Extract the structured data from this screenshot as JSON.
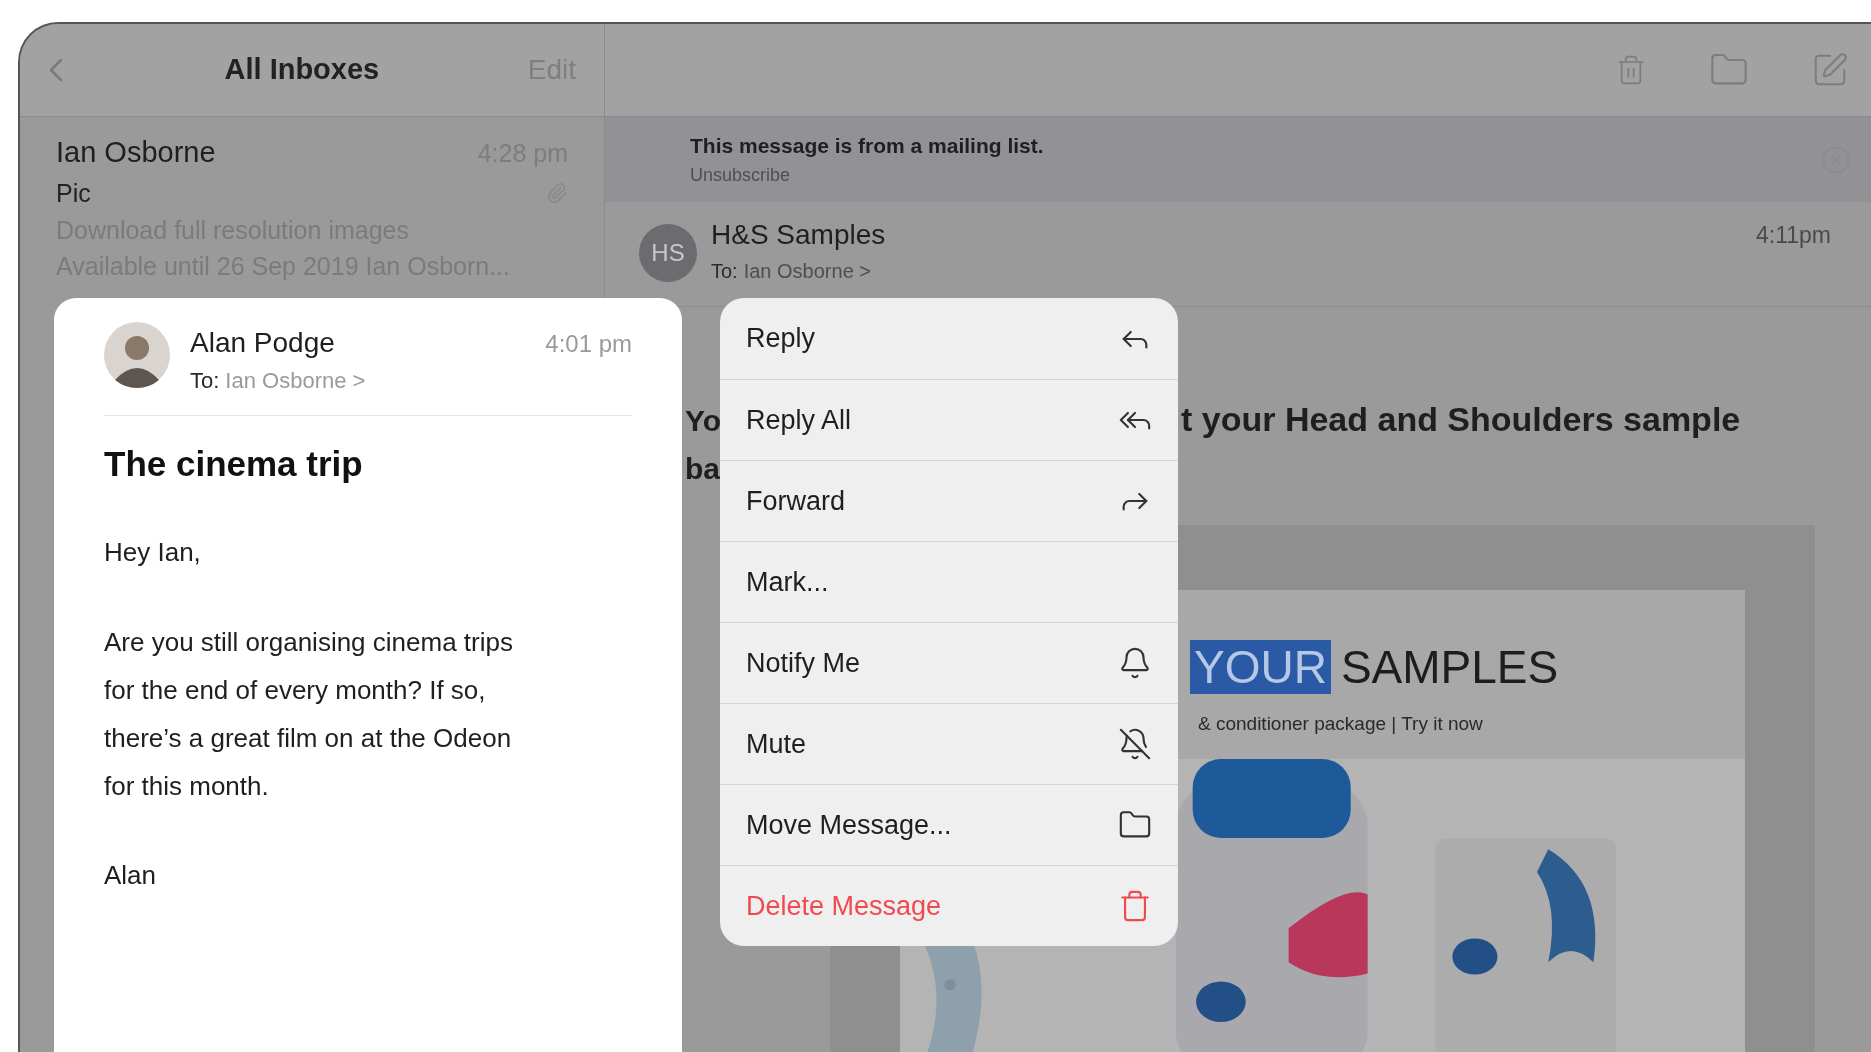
{
  "list_pane": {
    "title": "All Inboxes",
    "edit": "Edit",
    "message": {
      "sender": "Ian Osborne",
      "time": "4:28 pm",
      "subject": "Pic",
      "has_attachment": true,
      "preview_lines": [
        "Download full resolution images",
        "Available until 26 Sep 2019 Ian Osborn..."
      ]
    }
  },
  "banner": {
    "text": "This message is from a mailing list.",
    "link": "Unsubscribe"
  },
  "message_header": {
    "initials": "HS",
    "sender": "H&S Samples",
    "to_label": "To:",
    "recipient": "Ian Osborne >",
    "time": "4:11pm"
  },
  "subject_fragments": {
    "line_1_left": "Yo",
    "line_1_right": "t your Head and Shoulders sample",
    "line_2_left": "ba"
  },
  "newsletter": {
    "heading_highlight": "YOUR",
    "heading": "SAMPLES",
    "tagline": "& conditioner package | Try it now",
    "kind": "picture"
  },
  "preview": {
    "sender": "Alan Podge",
    "time": "4:01 pm",
    "to_label": "To:",
    "recipient": "Ian Osborne >",
    "subject": "The cinema trip",
    "greeting": "Hey Ian,",
    "body": "Are you still organising cinema trips for the end of every month? If so, there’s a great film on at the Odeon for this month.",
    "signoff": "Alan"
  },
  "menu": [
    {
      "label": "Reply",
      "kind": "reply",
      "destructive": false
    },
    {
      "label": "Reply All",
      "kind": "reply_all",
      "destructive": false
    },
    {
      "label": "Forward",
      "kind": "forward",
      "destructive": false
    },
    {
      "label": "Mark...",
      "kind": "mark",
      "destructive": false
    },
    {
      "label": "Notify Me",
      "kind": "notify",
      "destructive": false
    },
    {
      "label": "Mute",
      "kind": "mute",
      "destructive": false
    },
    {
      "label": "Move Message...",
      "kind": "move",
      "destructive": false
    },
    {
      "label": "Delete Message",
      "kind": "delete",
      "destructive": true
    }
  ]
}
